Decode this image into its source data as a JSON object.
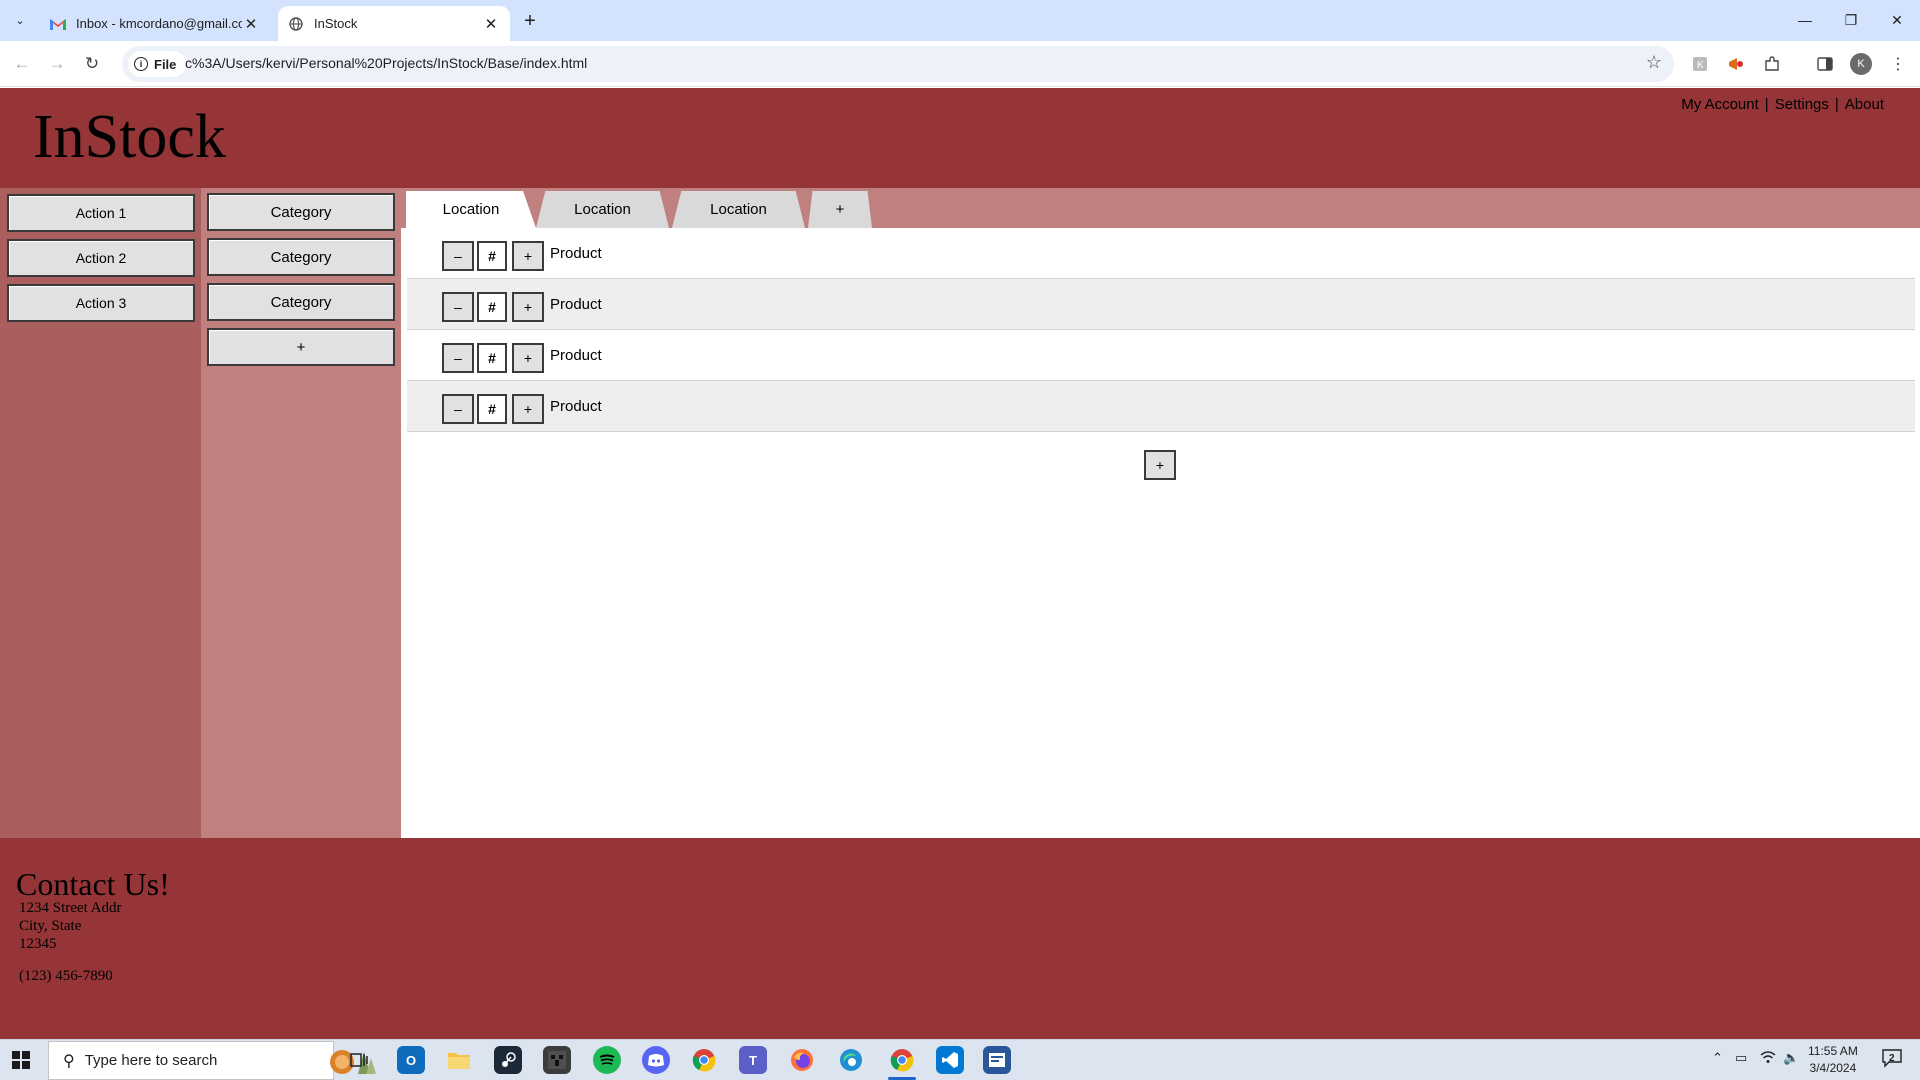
{
  "browser": {
    "tabs": [
      {
        "title": "Inbox - kmcordano@gmail.com",
        "active": false
      },
      {
        "title": "InStock",
        "active": true
      }
    ],
    "site_chip": "File",
    "url": "c%3A/Users/kervi/Personal%20Projects/InStock/Base/index.html",
    "profile_initial": "K"
  },
  "page": {
    "logo": "InStock",
    "top_links": [
      "My Account",
      "Settings",
      "About"
    ],
    "top_link_separator": "|",
    "actions": [
      "Action 1",
      "Action 2",
      "Action 3"
    ],
    "categories": [
      "Category",
      "Category",
      "Category"
    ],
    "add_category_label": "+",
    "location_tabs": [
      "Location",
      "Location",
      "Location"
    ],
    "add_location_label": "+",
    "products": [
      {
        "name": "Product",
        "minus": "–",
        "qty": "#",
        "plus": "+"
      },
      {
        "name": "Product",
        "minus": "–",
        "qty": "#",
        "plus": "+"
      },
      {
        "name": "Product",
        "minus": "–",
        "qty": "#",
        "plus": "+"
      },
      {
        "name": "Product",
        "minus": "–",
        "qty": "#",
        "plus": "+"
      }
    ],
    "add_product_label": "+",
    "footer": {
      "title": "Contact Us!",
      "address_line1": "1234 Street Addr",
      "address_line2": "City, State",
      "address_line3": "12345",
      "phone": "(123) 456-7890"
    }
  },
  "taskbar": {
    "search_placeholder": "Type here to search",
    "time": "11:55 AM",
    "date": "3/4/2024",
    "notification_count": "2"
  },
  "colors": {
    "header_bg": "#953537",
    "actions_bg": "#ab5e5e",
    "categories_bg": "#c08080"
  }
}
